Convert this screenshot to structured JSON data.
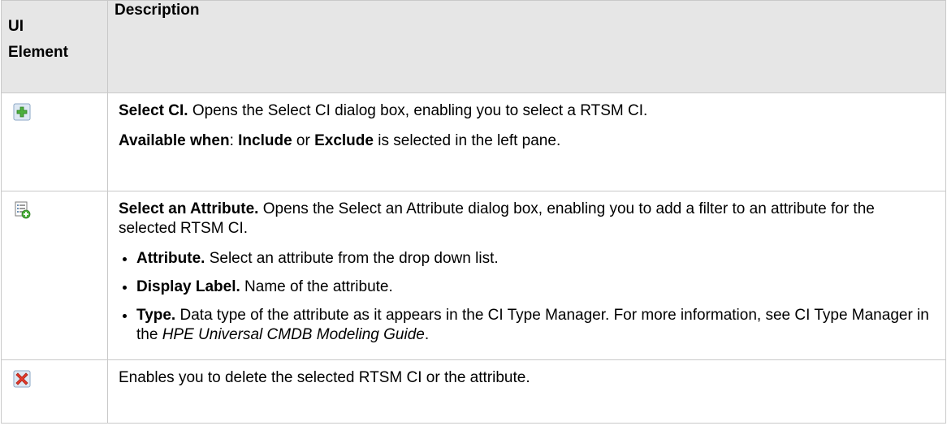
{
  "header": {
    "col1_line1": "UI",
    "col1_line2": "Element",
    "col2": "Description"
  },
  "rows": [
    {
      "icon": "add-green-plus-icon",
      "title": "Select CI.",
      "text": " Opens the Select CI dialog box, enabling you to select a RTSM CI.",
      "avail_label": "Available when",
      "avail_sep": ": ",
      "avail_opt1": "Include",
      "avail_or": " or ",
      "avail_opt2": "Exclude",
      "avail_rest": " is selected in the left pane."
    },
    {
      "icon": "list-add-attribute-icon",
      "title": "Select an Attribute.",
      "text": " Opens the Select an Attribute dialog box, enabling you to add a filter to an attribute for the selected RTSM CI.",
      "bullets": [
        {
          "label": "Attribute.",
          "text": " Select an attribute from the drop down list."
        },
        {
          "label": "Display Label.",
          "text": " Name of the attribute."
        },
        {
          "label": "Type.",
          "text": " Data type of the attribute as it appears in the CI Type Manager. For more information, see CI Type Manager in the ",
          "italic": "HPE Universal CMDB Modeling Guide",
          "tail": "."
        }
      ]
    },
    {
      "icon": "delete-red-x-icon",
      "text": "Enables you to delete the selected RTSM CI or the attribute."
    }
  ]
}
